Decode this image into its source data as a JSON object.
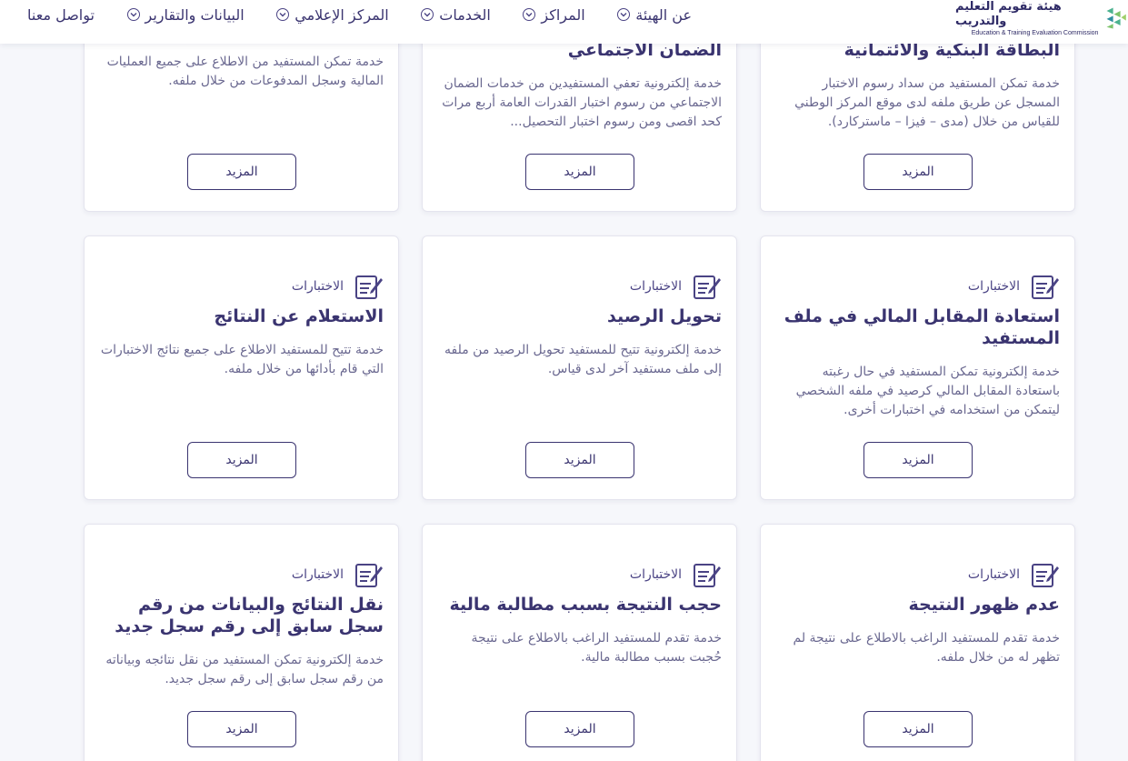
{
  "header": {
    "logo_ar": "هيئة تقويم التعليم والتدريب",
    "logo_en": "Education & Training Evaluation Commission",
    "nav": [
      {
        "label": "عن الهيئة"
      },
      {
        "label": "المراكز"
      },
      {
        "label": "الخدمات"
      },
      {
        "label": "المركز الإعلامي"
      },
      {
        "label": "البيانات والتقارير"
      },
      {
        "label": "تواصل معنا"
      }
    ]
  },
  "more_label": "المزيد",
  "category_label": "الاختبارات",
  "top_row": [
    {
      "title": "البطاقة البنكية والائتمانية",
      "desc": "خدمة تمكن المستفيد من سداد رسوم الاختبار المسجل عن طريق ملفه لدى موقع المركز الوطني للقياس من خلال (مدى – فيزا – ماستركارد)."
    },
    {
      "title": "الضمان الاجتماعي",
      "desc": "خدمة إلكترونية تعفي المستفيدين من خدمات الضمان الاجتماعي من رسوم اختبار القدرات العامة أربع مرات كحد اقصى ومن رسوم اختبار التحصيل..."
    },
    {
      "title": "",
      "desc": "خدمة تمكن المستفيد من الاطلاع على جميع العمليات المالية وسجل المدفوعات من خلال ملفه."
    }
  ],
  "middle_row": [
    {
      "title": "استعادة المقابل المالي في ملف المستفيد",
      "desc": "خدمة إلكترونية تمكن المستفيد في حال رغبته باستعادة المقابل المالي كرصيد في ملفه الشخصي ليتمكن من استخدامه في اختبارات أخرى."
    },
    {
      "title": "تحويل الرصيد",
      "desc": "خدمة إلكترونية تتيح للمستفيد تحويل الرصيد من ملفه إلى ملف مستفيد آخر لدى قياس."
    },
    {
      "title": "الاستعلام عن النتائج",
      "desc": "خدمة تتيح للمستفيد الاطلاع على جميع نتائج الاختبارات التي قام بأدائها من خلال ملفه."
    }
  ],
  "bottom_row": [
    {
      "title": "عدم ظهور النتيجة",
      "desc": "خدمة تقدم للمستفيد الراغب بالاطلاع على نتيجة لم تظهر له من خلال ملفه."
    },
    {
      "title": "حجب النتيجة بسبب مطالبة مالية",
      "desc": "خدمة تقدم للمستفيد الراغب بالاطلاع على نتيجة حُجبت بسبب مطالبة مالية."
    },
    {
      "title": "نقل النتائج والبيانات من رقم سجل سابق إلى رقم سجل جديد",
      "desc": "خدمة إلكترونية تمكن المستفيد من نقل نتائجه وبياناته من رقم سجل سابق إلى رقم سجل جديد."
    }
  ]
}
